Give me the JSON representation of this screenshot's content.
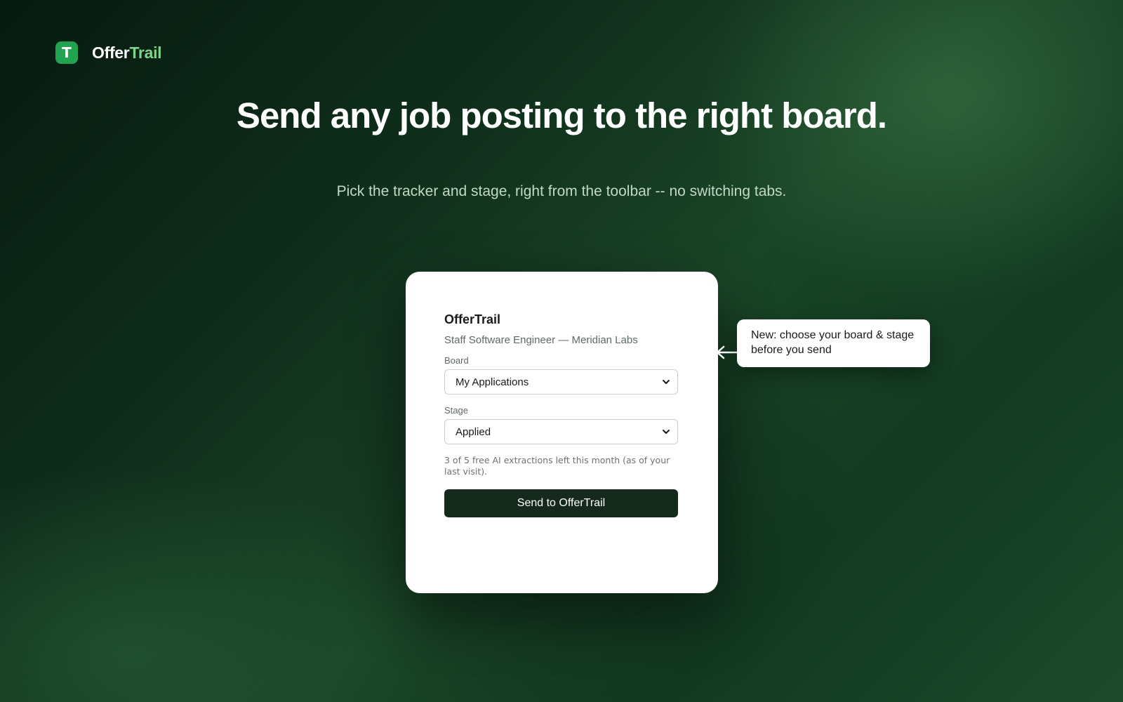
{
  "brand": {
    "mark": "T",
    "name_part1": "Offer",
    "name_part2": "Trail",
    "mark_color": "#22a352",
    "accent_color": "#7dd58b"
  },
  "hero": {
    "headline": "Send any job posting to the right board.",
    "subhead": "Pick the tracker and stage, right from the toolbar -- no switching tabs."
  },
  "popup": {
    "title": "OfferTrail",
    "job": "Staff Software Engineer — Meridian Labs",
    "board": {
      "label": "Board",
      "selected": "My Applications"
    },
    "stage": {
      "label": "Stage",
      "selected": "Applied"
    },
    "quota_text": "3 of 5 free AI extractions left this month (as of your last visit).",
    "send_label": "Send to OfferTrail",
    "button_color": "#15291c"
  },
  "callout": {
    "text": "New: choose your board & stage before you send"
  },
  "icons": {
    "logo": "logo-t-icon",
    "dropdown": "chevron-down-icon",
    "pointer": "arrow-left-icon"
  }
}
